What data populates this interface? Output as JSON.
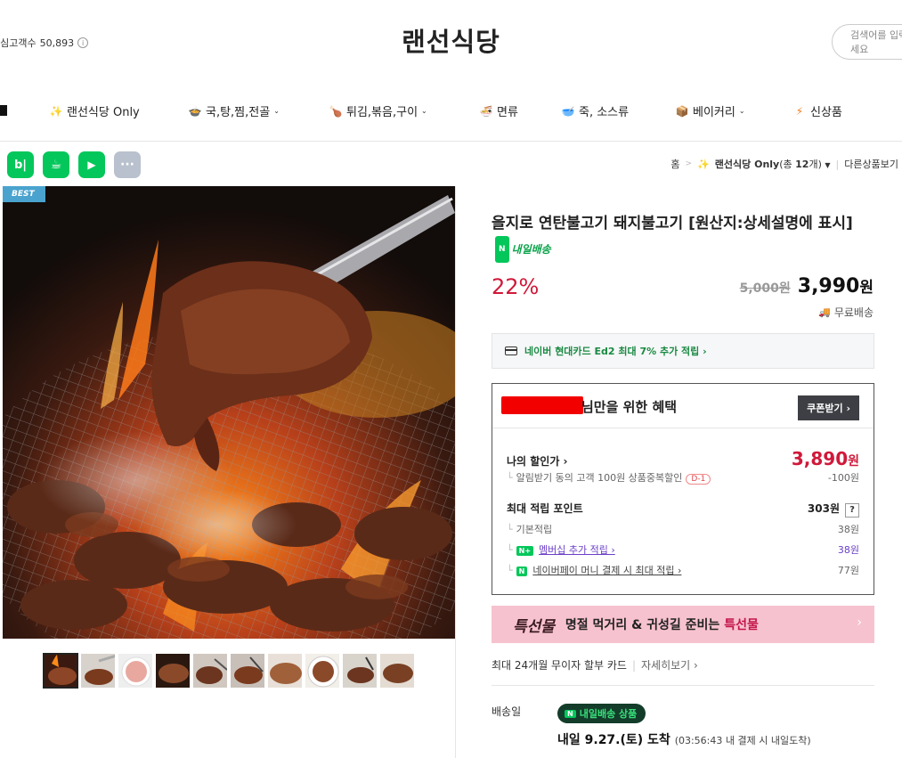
{
  "header": {
    "interest_label": "관심고객수",
    "interest_count": "50,893",
    "store_name": "랜선식당",
    "search_placeholder": "검색어를 입력해보세요"
  },
  "categories": [
    {
      "icon": "✨",
      "label": "랜선식당 Only",
      "has_dropdown": false
    },
    {
      "icon": "🍲",
      "label": "국,탕,찜,전골",
      "has_dropdown": true
    },
    {
      "icon": "🍗",
      "label": "튀김,볶음,구이",
      "has_dropdown": true
    },
    {
      "icon": "🍜",
      "label": "면류",
      "has_dropdown": false
    },
    {
      "icon": "🥣",
      "label": "죽, 소스류",
      "has_dropdown": false
    },
    {
      "icon": "📦",
      "label": "베이커리",
      "has_dropdown": true
    },
    {
      "icon": "⚡",
      "label": "신상품",
      "has_dropdown": false
    }
  ],
  "share": {
    "blog": "b|",
    "kakao": "☕",
    "bookmark": "▶",
    "more": "···"
  },
  "breadcrumb": {
    "home": "홈",
    "category_icon": "✨",
    "category": "랜선식당 Only",
    "count_prefix": "(총 ",
    "count": "12",
    "count_suffix": "개)",
    "other": "다른상품보기"
  },
  "product": {
    "badge": "BEST",
    "title": "을지로 연탄불고기 돼지불고기 [원산지:상세설명에 표시]",
    "next_day_badge": "내일배송",
    "discount": "22%",
    "original_price": "5,000원",
    "sale_price": "3,990",
    "currency": "원",
    "shipping": "무료배송"
  },
  "card_promo": {
    "text": "네이버 현대카드 Ed2 최대 7% 추가 적립 ›"
  },
  "benefit": {
    "title": "님만을 위한 혜택",
    "coupon_button": "쿠폰받기 ›",
    "my_discount_label": "나의 할인가 ›",
    "my_discount_price": "3,890",
    "my_discount_currency": "원",
    "alarm_text": "알림받기 동의 고객 100원 상품중복할인",
    "alarm_badge": "D-1",
    "alarm_amount": "-100원",
    "max_point_label": "최대 적립 포인트",
    "max_point_value": "303원",
    "help": "?",
    "basic_label": "기본적립",
    "basic_value": "38원",
    "membership_label": "멤버십 추가 적립 ›",
    "membership_value": "38원",
    "npay_label": "네이버페이 머니 결제 시 최대 적립 ›",
    "npay_value": "77원"
  },
  "banner": {
    "logo": "특선물",
    "text_prefix": "명절 먹거리 & 귀성길 준비는 ",
    "text_highlight": "특선물",
    "arrow": "›"
  },
  "installment": {
    "text": "최대 24개월 무이자 할부 카드",
    "separator": "|",
    "detail": "자세히보기 ›"
  },
  "delivery": {
    "label": "배송일",
    "badge": "내일배송 상품",
    "arrival": "내일 9.27.(토) 도착",
    "note": "(03:56:43 내 결제 시 내일도착)"
  },
  "colors": {
    "discount_red": "#d0193a",
    "naver_green": "#03c75a",
    "banner_pink": "#f7c2cf",
    "best_blue": "#4aa3ce"
  }
}
